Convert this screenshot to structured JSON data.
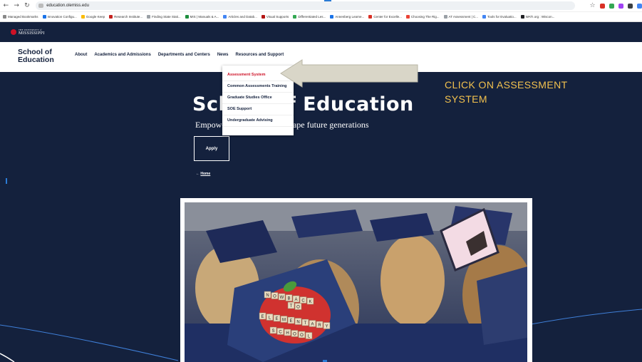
{
  "browser": {
    "url": "education.olemiss.edu",
    "bookmarks": [
      {
        "label": "Managed Bookmarks",
        "color": "#888888"
      },
      {
        "label": "Innovation Configu...",
        "color": "#1a73e8"
      },
      {
        "label": "Google Keep",
        "color": "#fbbc04"
      },
      {
        "label": "Research Institute...",
        "color": "#c5221f"
      },
      {
        "label": "Finding State Stati...",
        "color": "#9aa0a6"
      },
      {
        "label": "MIS | Manuals & A...",
        "color": "#1e8e3e"
      },
      {
        "label": "Articles and Datab...",
        "color": "#4285f4"
      },
      {
        "label": "Visual Supports",
        "color": "#b31412"
      },
      {
        "label": "Differentiated Les...",
        "color": "#34a853"
      },
      {
        "label": "Annenberg Learne...",
        "color": "#1a73e8"
      },
      {
        "label": "Center for Excelle...",
        "color": "#d93025"
      },
      {
        "label": "Choosing The Rig...",
        "color": "#ea4335"
      },
      {
        "label": "AT Assessment | C...",
        "color": "#9aa0a6"
      },
      {
        "label": "Tools for Evaluatio...",
        "color": "#4285f4"
      },
      {
        "label": "WATI.org : Wiscon...",
        "color": "#202124"
      }
    ]
  },
  "site": {
    "logo_text": "MISSISSIPPI",
    "logo_small": "THE UNIVERSITY of",
    "school_title_line1": "School of",
    "school_title_line2": "Education",
    "nav": [
      "About",
      "Academics and Admissions",
      "Departments and Centers",
      "News",
      "Resources and Support"
    ],
    "hero_title": "School of Education",
    "hero_sub": "Empowering educators to shape future generations",
    "apply_label": "Apply",
    "home_label": "Home",
    "dropdown": [
      {
        "label": "Assessment System",
        "active": true
      },
      {
        "label": "Common Assessments Training",
        "active": false
      },
      {
        "label": "Graduate Studies Office",
        "active": false
      },
      {
        "label": "SOE Support",
        "active": false
      },
      {
        "label": "Undergraduate Advising",
        "active": false
      }
    ]
  },
  "annotation": {
    "line1": "CLICK ON ASSESSMENT",
    "line2": "SYSTEM"
  },
  "colors": {
    "navy": "#14213d",
    "red": "#ce1126",
    "annotation": "#f2c14e"
  },
  "cap_letters": [
    "N",
    "O",
    "W",
    "B",
    "A",
    "C",
    "K",
    "T",
    "O",
    "E",
    "L",
    "E",
    "M",
    "E",
    "N",
    "T",
    "A",
    "R",
    "Y",
    "S",
    "C",
    "H",
    "O",
    "O",
    "L"
  ]
}
